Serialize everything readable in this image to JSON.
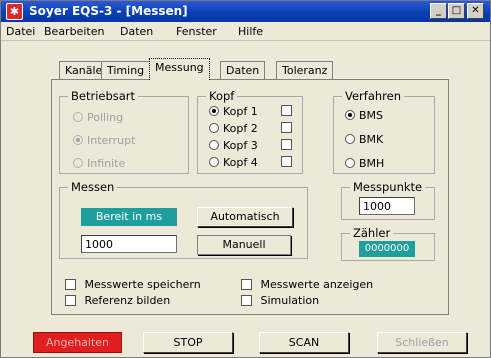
{
  "window": {
    "title": "Soyer EQS-3 - [Messen]",
    "icon_text": "✱",
    "controls": {
      "minimize": "_",
      "maximize": "□",
      "close": "✕"
    }
  },
  "menu": [
    "Datei",
    "Bearbeiten",
    "Daten",
    "Fenster",
    "Hilfe"
  ],
  "tabs": [
    {
      "label": "Kanäle",
      "active": false
    },
    {
      "label": "Timing",
      "active": false
    },
    {
      "label": "Messung",
      "active": true
    },
    {
      "label": "Daten",
      "active": false
    },
    {
      "label": "Toleranz",
      "active": false
    }
  ],
  "betriebsart": {
    "title": "Betriebsart",
    "options": [
      "Polling",
      "Interrupt",
      "Infinite"
    ],
    "selected": "Interrupt",
    "enabled": false
  },
  "kopf": {
    "title": "Kopf",
    "options": [
      "Kopf 1",
      "Kopf 2",
      "Kopf 3",
      "Kopf 4"
    ],
    "selected": "Kopf 1"
  },
  "verfahren": {
    "title": "Verfahren",
    "options": [
      "BMS",
      "BMK",
      "BMH"
    ],
    "selected": "BMS"
  },
  "messen": {
    "title": "Messen",
    "status": "Bereit in ms",
    "automatisch": "Automatisch",
    "value": "1000",
    "manuell": "Manuell"
  },
  "messpunkte": {
    "title": "Messpunkte",
    "value": "1000"
  },
  "zaehler": {
    "title": "Zähler",
    "value": "0000000"
  },
  "checkboxes": {
    "messwerte_speichern": "Messwerte speichern",
    "messwerte_anzeigen": "Messwerte anzeigen",
    "referenz_bilden": "Referenz bilden",
    "simulation": "Simulation"
  },
  "bottom": {
    "angehalten": "Angehalten",
    "stop": "STOP",
    "scan": "SCAN",
    "schliessen": "Schließen"
  },
  "colors": {
    "titlebar": "#0a3fb3",
    "teal": "#1f9e9e",
    "stopped_red": "#e02020"
  }
}
